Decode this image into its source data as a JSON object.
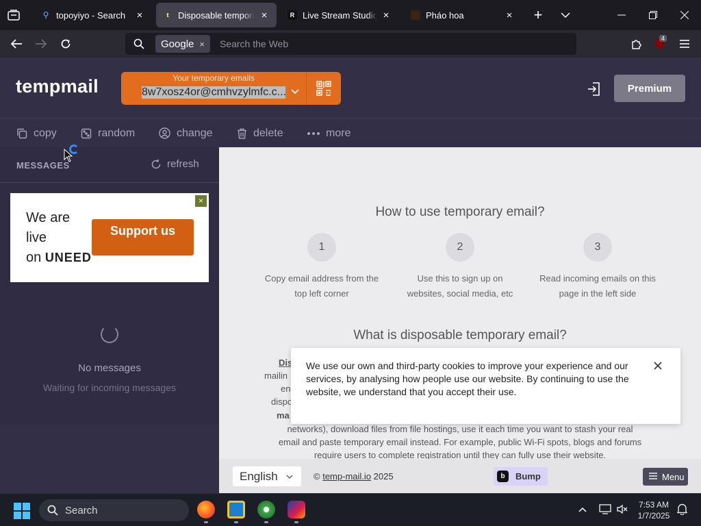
{
  "browser": {
    "tabs": [
      {
        "title": "topoyiyo - Search",
        "favicon": "search-favicon",
        "active": false
      },
      {
        "title": "Disposable temporary e",
        "favicon": "t",
        "active": true
      },
      {
        "title": "Live Stream Studio | Re",
        "favicon": "R",
        "active": false
      },
      {
        "title": "Pháo hoa",
        "favicon": "firework-favicon",
        "active": false
      }
    ],
    "search_engine": "Google",
    "url_placeholder": "Search the Web",
    "extension_badge": "4"
  },
  "site": {
    "logo": "tempmail",
    "email_caption": "Your temporary emails",
    "email_value": "8w7xosz4or@cmhvzylmfc.c...",
    "premium_label": "Premium",
    "accent_color": "#e26d1e",
    "toolbar": {
      "copy": "copy",
      "random": "random",
      "change": "change",
      "delete": "delete",
      "more": "more"
    }
  },
  "inbox": {
    "title": "MESSAGES",
    "refresh": "refresh",
    "ad": {
      "line1": "We are",
      "line2": "live",
      "line3": "on",
      "brand": "UNEED",
      "button": "Support us"
    },
    "empty_title": "No messages",
    "empty_sub": "Waiting for incoming messages"
  },
  "main": {
    "how_title": "How to use temporary email?",
    "steps": [
      {
        "num": "1",
        "desc": "Copy email address from the top left corner"
      },
      {
        "num": "2",
        "desc": "Use this to sign up on websites, social media, etc"
      },
      {
        "num": "3",
        "desc": "Read incoming emails on this page in the left side"
      }
    ],
    "what_title": "What is disposable temporary email?",
    "para_frags": [
      "Dis",
      "mailin",
      "en",
      "dispo",
      "ma"
    ],
    "para_line1": "networks), download files from file hostings, use it each time you want to stash your real",
    "para_line2": "email and paste temporary email instead. For example, public Wi-Fi spots, blogs and forums",
    "para_line3": "require users to complete registration until they can fully use their website."
  },
  "cookie": {
    "text": "We use our own and third-party cookies to improve your experience and our services, by analysing how people use our website. By continuing to use the website, we understand that you accept their use."
  },
  "footer": {
    "language": "English",
    "copyright_symbol": "©",
    "site_link": "temp-mail.io",
    "year": "2025",
    "bump": "Bump",
    "menu": "Menu"
  },
  "taskbar": {
    "search": "Search",
    "time": "7:53 AM",
    "date": "1/7/2025"
  }
}
